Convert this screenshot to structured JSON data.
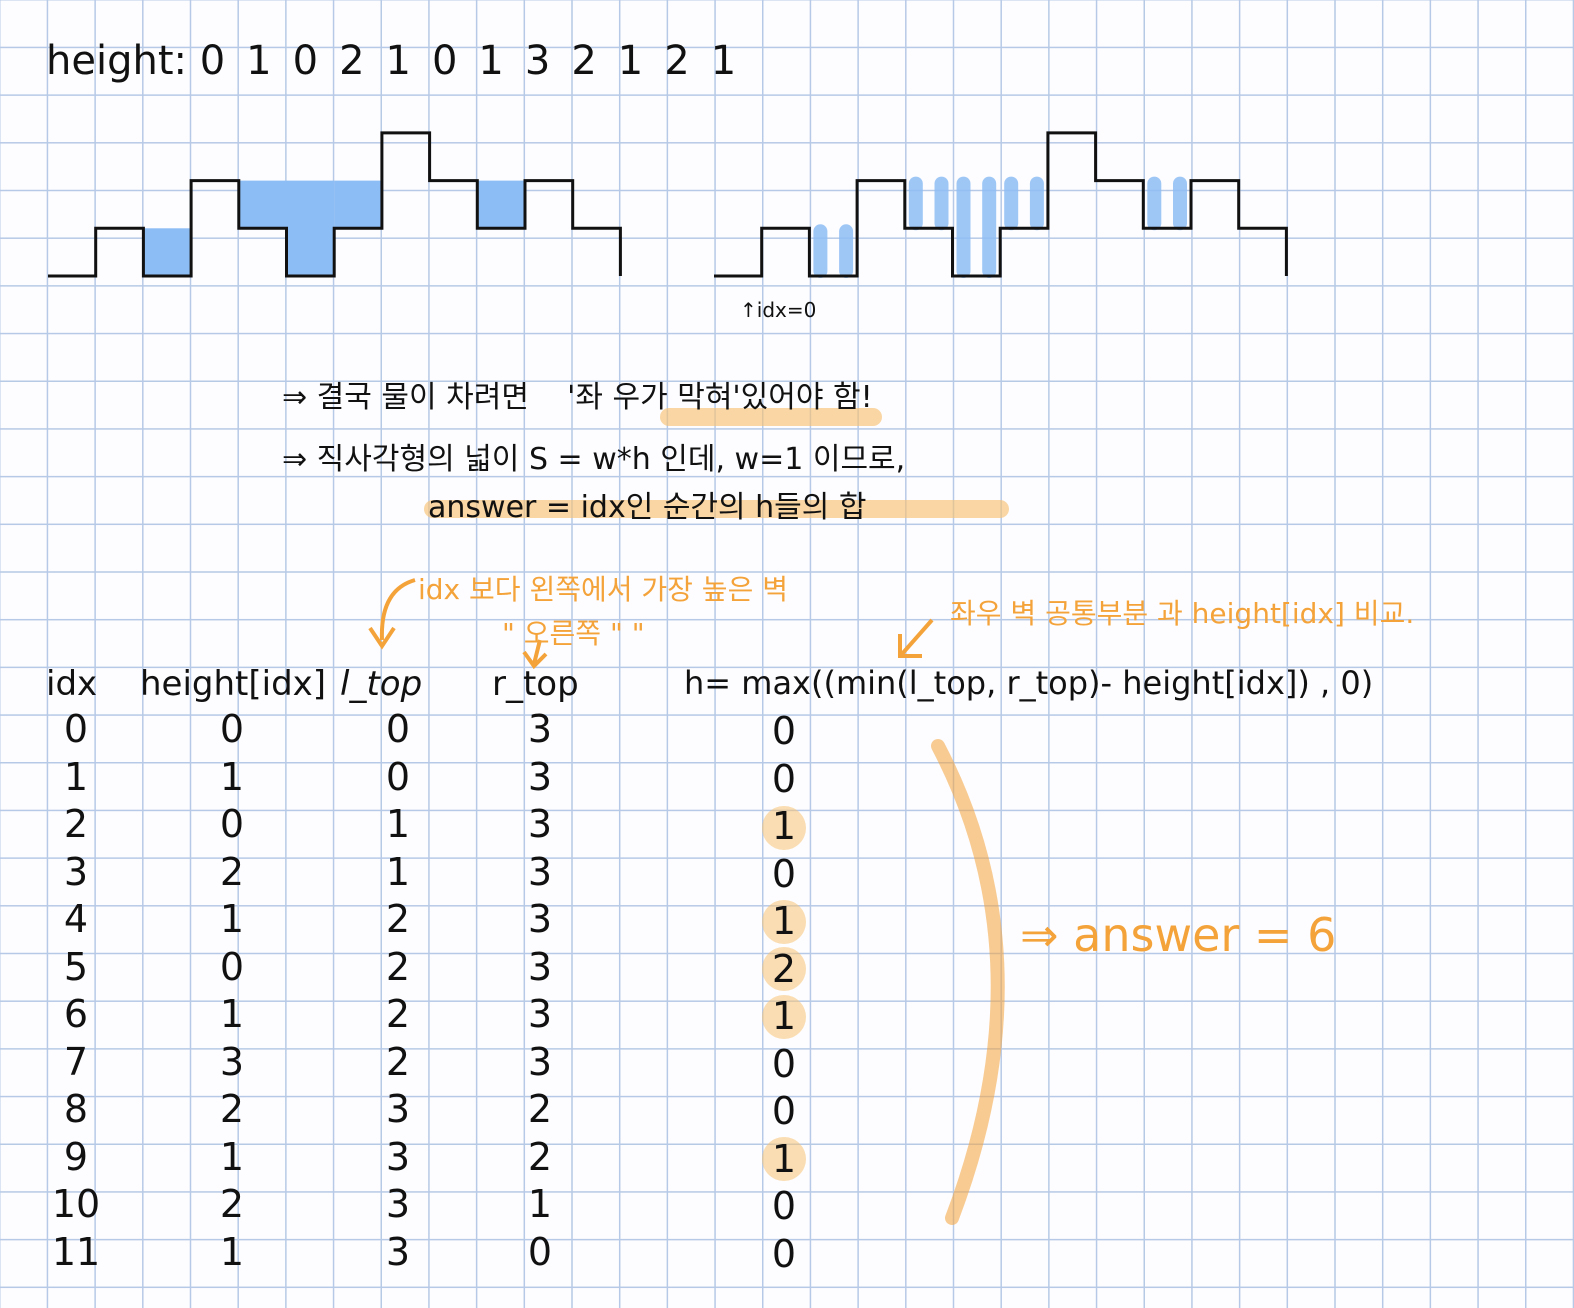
{
  "title": {
    "label": "height:",
    "values": [
      "0",
      "1",
      "0",
      "2",
      "1",
      "0",
      "1",
      "3",
      "2",
      "1",
      "2",
      "1"
    ]
  },
  "left_figure": {
    "heights": [
      0,
      1,
      0,
      2,
      1,
      0,
      1,
      3,
      2,
      1,
      2,
      1
    ],
    "water": [
      0,
      0,
      1,
      0,
      1,
      2,
      1,
      0,
      0,
      1,
      0,
      0
    ],
    "water_color": "#8dbdf5"
  },
  "right_figure": {
    "idx_label": "idx=0",
    "bar_color": "#8dbdf5"
  },
  "notes": {
    "line1_a": "⇒ 결국 물이 차려면",
    "line1_b": "'좌 우가 막혀'있어야 함!",
    "line2": "⇒ 직사각형의 넓이 S = w*h 인데, w=1 이므로,",
    "line3": "answer = idx인 순간의 h들의 합"
  },
  "annotations": {
    "l_top_note": "idx 보다 왼쪽에서 가장 높은 벽",
    "r_top_note": "\" 오른쪽 \" \"",
    "h_note": "좌우 벽 공통부분 과 height[idx] 비교.",
    "answer": "⇒ answer = 6",
    "accent_color": "#f4a33a"
  },
  "table": {
    "headers": {
      "idx": "idx",
      "height": "height[idx]",
      "l_top": "l_top",
      "r_top": "r_top",
      "h": "h= max((min(l_top, r_top)- height[idx]) , 0)"
    },
    "idx": [
      "0",
      "1",
      "2",
      "3",
      "4",
      "5",
      "6",
      "7",
      "8",
      "9",
      "10",
      "11"
    ],
    "height": [
      "0",
      "1",
      "0",
      "2",
      "1",
      "0",
      "1",
      "3",
      "2",
      "1",
      "2",
      "1"
    ],
    "l_top": [
      "0",
      "0",
      "1",
      "1",
      "2",
      "2",
      "2",
      "2",
      "3",
      "3",
      "3",
      "3"
    ],
    "r_top": [
      "3",
      "3",
      "3",
      "3",
      "3",
      "3",
      "3",
      "3",
      "2",
      "2",
      "1",
      "0"
    ],
    "h": [
      "0",
      "0",
      "1",
      "0",
      "1",
      "2",
      "1",
      "0",
      "0",
      "1",
      "0",
      "0"
    ]
  }
}
